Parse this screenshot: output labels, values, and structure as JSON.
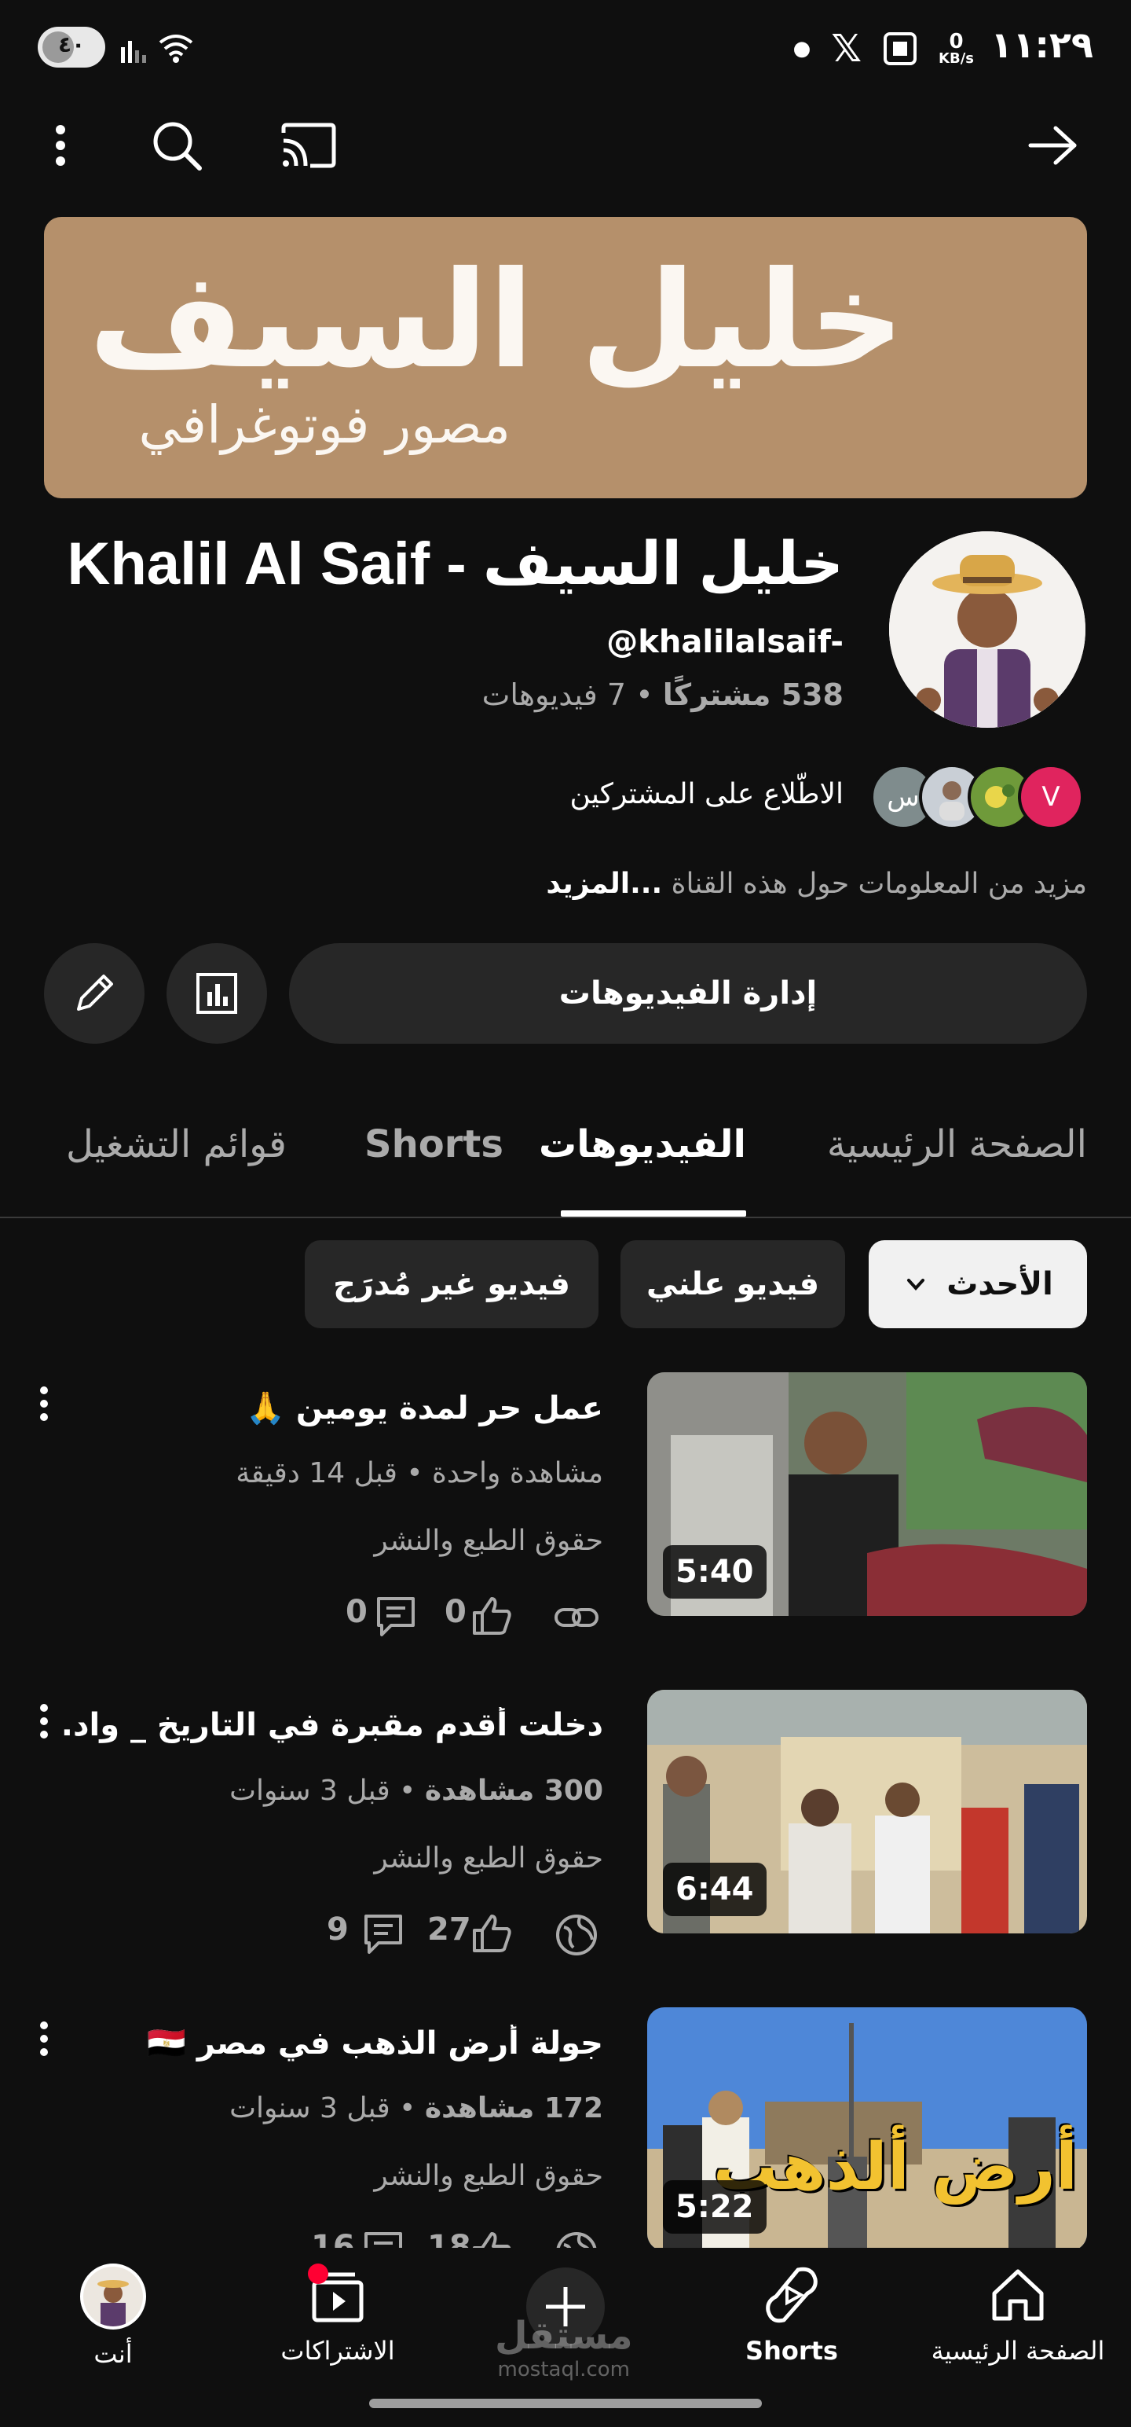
{
  "status_bar": {
    "battery": "٤٠",
    "time": "١١:٢٩",
    "net_speed_value": "0",
    "net_speed_unit": "KB/s"
  },
  "banner": {
    "title": "خليل السيف",
    "subtitle": "مصور فوتوغرافي"
  },
  "channel": {
    "name": "Khalil Al Saif - خليل السيف",
    "handle": "@khalilalsaif-",
    "subscribers": "538 مشتركًا",
    "videos_count": "7 فيديوهات",
    "stats_separator": "•",
    "see_subscribers": "الاطّلاع على المشتركين",
    "subscriber_avatar_letters": [
      "V",
      "س"
    ],
    "more_about": "مزيد من المعلومات حول هذه القناة",
    "more_link": "...المزيد",
    "manage_videos": "إدارة الفيديوهات"
  },
  "tabs": [
    "الصفحة الرئيسية",
    "الفيديوهات",
    "Shorts",
    "قوائم التشغيل"
  ],
  "active_tab": "الفيديوهات",
  "filters": {
    "sort_label": "الأحدث",
    "chips": [
      "فيديو علني",
      "فيديو غير مُدرَج"
    ]
  },
  "videos": [
    {
      "title": "عمل حر لمدة يومين 🙏",
      "views": "مشاهدة واحدة",
      "age": "قبل 14 دقيقة",
      "rights": "حقوق الطبع والنشر",
      "duration": "5:40",
      "likes": "0",
      "comments": "0",
      "visibility_icon": "link-icon"
    },
    {
      "title": "دخلت أقدم مقبرة في التاريخ _ واد...",
      "views": "300 مشاهدة",
      "age": "قبل 3 سنوات",
      "rights": "حقوق الطبع والنشر",
      "duration": "6:44",
      "likes": "27",
      "comments": "9",
      "visibility_icon": "globe-icon"
    },
    {
      "title": "جولة أرض الذهب في مصر 🇪🇬",
      "views": "172 مشاهدة",
      "age": "قبل 3 سنوات",
      "rights": "حقوق الطبع والنشر",
      "duration": "5:22",
      "thumb_overlay": "أرض ألذهب",
      "likes": "18",
      "comments": "16",
      "visibility_icon": "globe-icon"
    }
  ],
  "meta_separator": "•",
  "bottom_nav": {
    "home": "الصفحة الرئيسية",
    "shorts": "Shorts",
    "subscriptions": "الاشتراكات",
    "you": "أنت"
  },
  "watermark": {
    "arabic": "مستقل",
    "latin": "mostaql.com"
  },
  "colors": {
    "background": "#0f0f0f",
    "surface": "#272727",
    "banner": "#b5906b",
    "notification_dot": "#ff0033"
  }
}
